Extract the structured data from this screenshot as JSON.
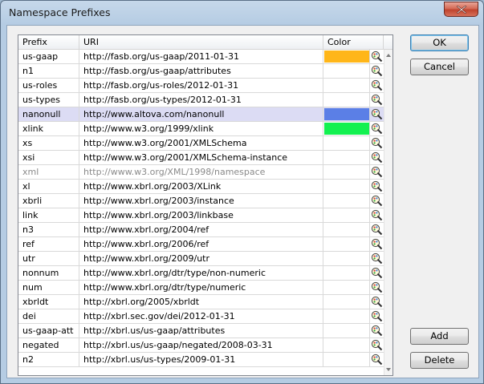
{
  "window": {
    "title": "Namespace Prefixes"
  },
  "table": {
    "columns": {
      "prefix": "Prefix",
      "uri": "URI",
      "color": "Color"
    },
    "rows": [
      {
        "prefix": "us-gaap",
        "uri": "http://fasb.org/us-gaap/2011-01-31",
        "color": "#ffb619"
      },
      {
        "prefix": "n1",
        "uri": "http://fasb.org/us-gaap/attributes",
        "color": ""
      },
      {
        "prefix": "us-roles",
        "uri": "http://fasb.org/us-roles/2012-01-31",
        "color": ""
      },
      {
        "prefix": "us-types",
        "uri": "http://fasb.org/us-types/2012-01-31",
        "color": ""
      },
      {
        "prefix": "nanonull",
        "uri": "http://www.altova.com/nanonull",
        "color": "#5b7fe6",
        "selected": true
      },
      {
        "prefix": "xlink",
        "uri": "http://www.w3.org/1999/xlink",
        "color": "#13f150"
      },
      {
        "prefix": "xs",
        "uri": "http://www.w3.org/2001/XMLSchema",
        "color": ""
      },
      {
        "prefix": "xsi",
        "uri": "http://www.w3.org/2001/XMLSchema-instance",
        "color": ""
      },
      {
        "prefix": "xml",
        "uri": "http://www.w3.org/XML/1998/namespace",
        "color": "",
        "disabled": true
      },
      {
        "prefix": "xl",
        "uri": "http://www.xbrl.org/2003/XLink",
        "color": ""
      },
      {
        "prefix": "xbrli",
        "uri": "http://www.xbrl.org/2003/instance",
        "color": ""
      },
      {
        "prefix": "link",
        "uri": "http://www.xbrl.org/2003/linkbase",
        "color": ""
      },
      {
        "prefix": "n3",
        "uri": "http://www.xbrl.org/2004/ref",
        "color": ""
      },
      {
        "prefix": "ref",
        "uri": "http://www.xbrl.org/2006/ref",
        "color": ""
      },
      {
        "prefix": "utr",
        "uri": "http://www.xbrl.org/2009/utr",
        "color": ""
      },
      {
        "prefix": "nonnum",
        "uri": "http://www.xbrl.org/dtr/type/non-numeric",
        "color": ""
      },
      {
        "prefix": "num",
        "uri": "http://www.xbrl.org/dtr/type/numeric",
        "color": ""
      },
      {
        "prefix": "xbrldt",
        "uri": "http://xbrl.org/2005/xbrldt",
        "color": ""
      },
      {
        "prefix": "dei",
        "uri": "http://xbrl.sec.gov/dei/2012-01-31",
        "color": ""
      },
      {
        "prefix": "us-gaap-att",
        "uri": "http://xbrl.us/us-gaap/attributes",
        "color": ""
      },
      {
        "prefix": "negated",
        "uri": "http://xbrl.us/us-gaap/negated/2008-03-31",
        "color": ""
      },
      {
        "prefix": "n2",
        "uri": "http://xbrl.us/us-types/2009-01-31",
        "color": ""
      }
    ],
    "color_picker_icon": "color-picker-icon"
  },
  "buttons": {
    "ok": "OK",
    "cancel": "Cancel",
    "add": "Add",
    "delete": "Delete"
  }
}
